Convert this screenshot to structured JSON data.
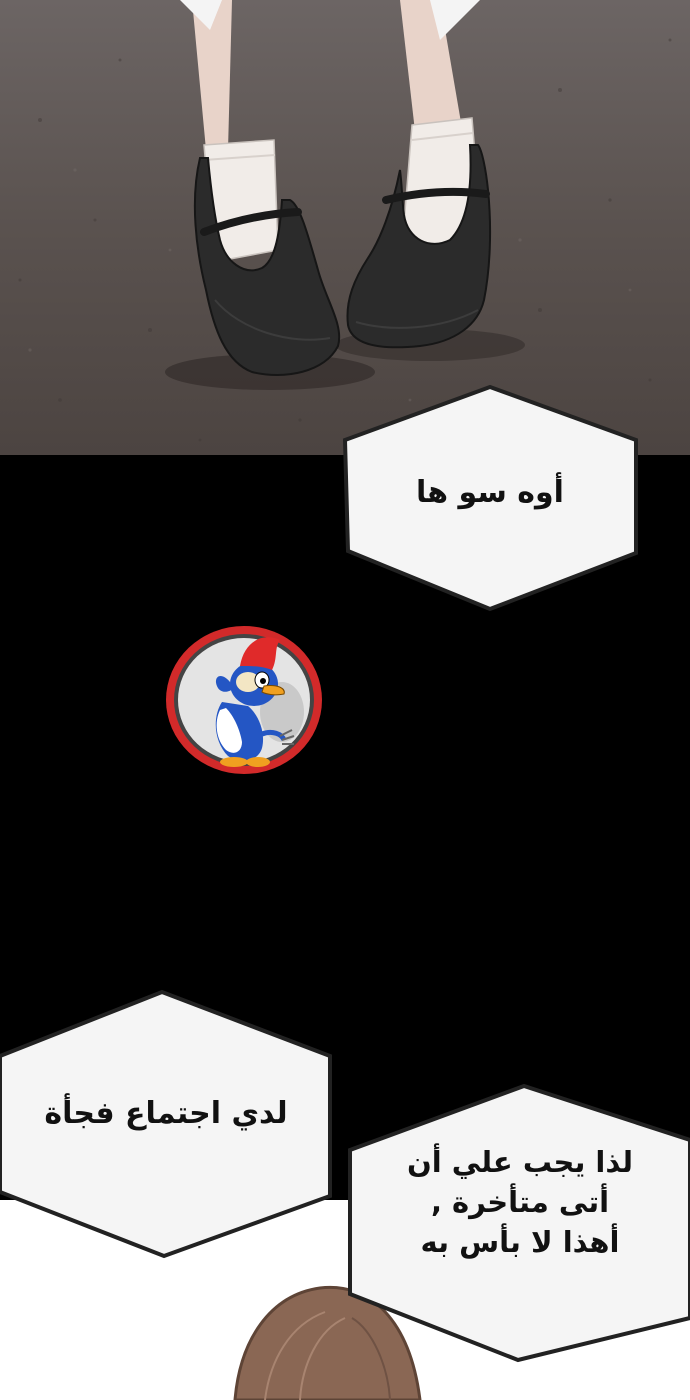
{
  "bubbles": {
    "oh_so": {
      "text": "أوه سو ها"
    },
    "meeting": {
      "text": "لدي اجتماع فجأة"
    },
    "late": {
      "lines": [
        "لذا يجب علي أن",
        "أتى متأخرة ,",
        "أهذا لا بأس به"
      ]
    }
  },
  "logo": {
    "name": "woodpecker-logo"
  },
  "colors": {
    "ground": "#5b5452",
    "shoe": "#2b2b2b",
    "sock": "#f1ece8",
    "skin": "#e8d3c9",
    "hair": "#8a6754",
    "bubble_fill": "#f5f5f5",
    "bubble_stroke": "#222222",
    "logo_ring": "#d22a2a"
  }
}
